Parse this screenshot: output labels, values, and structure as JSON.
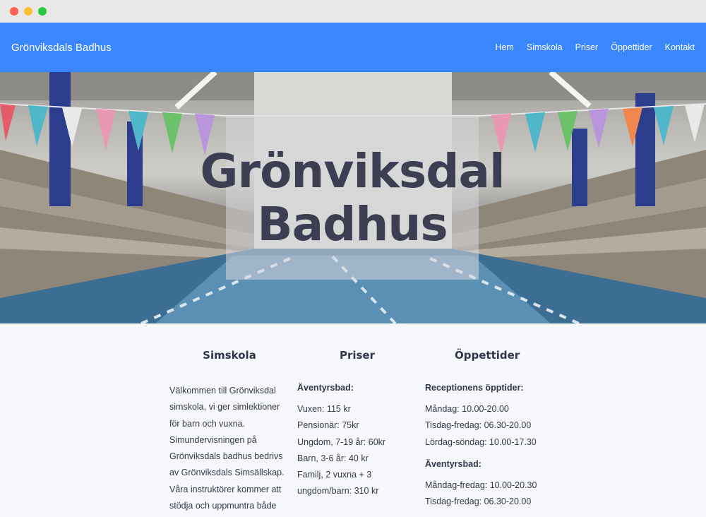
{
  "navbar": {
    "brand": "Grönviksdals Badhus",
    "items": [
      {
        "label": "Hem"
      },
      {
        "label": "Simskola"
      },
      {
        "label": "Priser"
      },
      {
        "label": "Öppettider"
      },
      {
        "label": "Kontakt"
      }
    ]
  },
  "hero": {
    "title_line1": "Grönviksdal",
    "title_line2": "Badhus"
  },
  "simskola": {
    "heading": "Simskola",
    "text": "Välkommen till Grönviksdal simskola, vi ger simlektioner för barn och vuxna. Simundervisningen på Grönviksdals badhus bedrivs av Grönviksdals Simsällskap. Våra instruktörer kommer att stödja och uppmuntra både"
  },
  "priser": {
    "heading": "Priser",
    "subheading": "Äventyrsbad:",
    "lines": [
      "Vuxen: 115 kr",
      "Pensionär: 75kr",
      "Ungdom, 7-19 år: 60kr",
      "Barn, 3-6 år: 40 kr",
      "Familj, 2 vuxna + 3",
      "ungdom/barn: 310 kr"
    ]
  },
  "oppettider": {
    "heading": "Öppettider",
    "reception_heading": "Receptionens öpptider:",
    "reception_lines": [
      "Måndag: 10.00-20.00",
      "Tisdag-fredag: 06.30-20.00",
      "Lördag-söndag: 10.00-17.30"
    ],
    "bath_heading": "Äventyrsbad:",
    "bath_lines": [
      "Måndag-fredag: 10.00-20.30",
      "Tisdag-fredag: 06.30-20.00"
    ]
  },
  "colors": {
    "navbar": "#3a87fd",
    "heading_text": "#33364a",
    "hero_title": "#3c3e52"
  }
}
